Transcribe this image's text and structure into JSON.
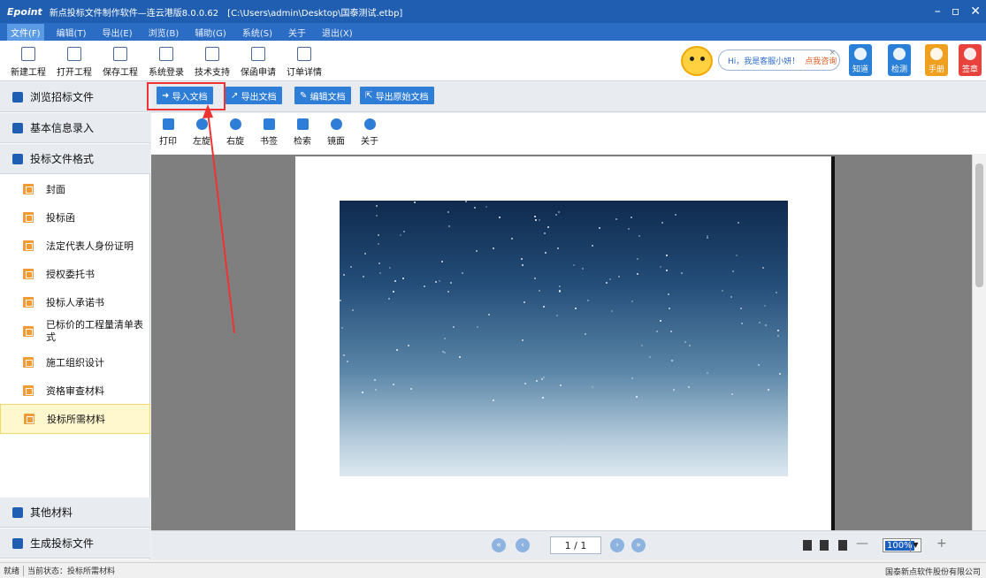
{
  "window": {
    "brand": "Epoint",
    "title": "新点投标文件制作软件—连云港版8.0.0.62",
    "path": "[C:\\Users\\admin\\Desktop\\国泰测试.etbp]",
    "minimize": "–",
    "restore": "▫",
    "close": "✕"
  },
  "menu": {
    "items": [
      "文件(F)",
      "编辑(T)",
      "导出(E)",
      "浏览(B)",
      "辅助(G)",
      "系统(S)",
      "关于",
      "退出(X)"
    ]
  },
  "toolbar": {
    "buttons": [
      "新建工程",
      "打开工程",
      "保存工程",
      "系统登录",
      "技术支持",
      "保函申请",
      "订单详情"
    ]
  },
  "assistant": {
    "greeting": "Hi，我是客服小妍！",
    "ask": "点我咨询",
    "close": "×"
  },
  "quick": [
    {
      "label": "知道",
      "color": "#2a7fd6"
    },
    {
      "label": "检测",
      "color": "#2a7fd6"
    },
    {
      "label": "手册",
      "color": "#f0a020"
    },
    {
      "label": "签章",
      "color": "#e8423d"
    }
  ],
  "sidebar": {
    "sections": {
      "browse": "浏览招标文件",
      "basic": "基本信息录入",
      "format": "投标文件格式",
      "other": "其他材料",
      "generate": "生成投标文件"
    },
    "items": [
      "封面",
      "投标函",
      "法定代表人身份证明",
      "授权委托书",
      "投标人承诺书",
      "已标价的工程量清单表式",
      "施工组织设计",
      "资格审查材料",
      "投标所需材料"
    ],
    "selected": "投标所需材料"
  },
  "docbar": {
    "import": "导入文档",
    "export": "导出文档",
    "edit": "编辑文档",
    "export_original": "导出原始文档"
  },
  "viewer": {
    "tools": [
      "打印",
      "左旋",
      "右旋",
      "书签",
      "检索",
      "镜面",
      "关于"
    ]
  },
  "nav": {
    "page": "1 / 1",
    "zoom": "100%",
    "minus": "—",
    "plus": "+",
    "first": "«",
    "prev": "‹",
    "next": "›",
    "last": "»"
  },
  "status": {
    "ready": "就绪",
    "state": "当前状态：",
    "current": "投标所需材料",
    "company": "国泰新点软件股份有限公司"
  },
  "colors": {
    "title_bar": "#1f5eb0",
    "menu_bar": "#2b6cc4",
    "accent": "#2e7dd6",
    "annotation": "#e33"
  }
}
